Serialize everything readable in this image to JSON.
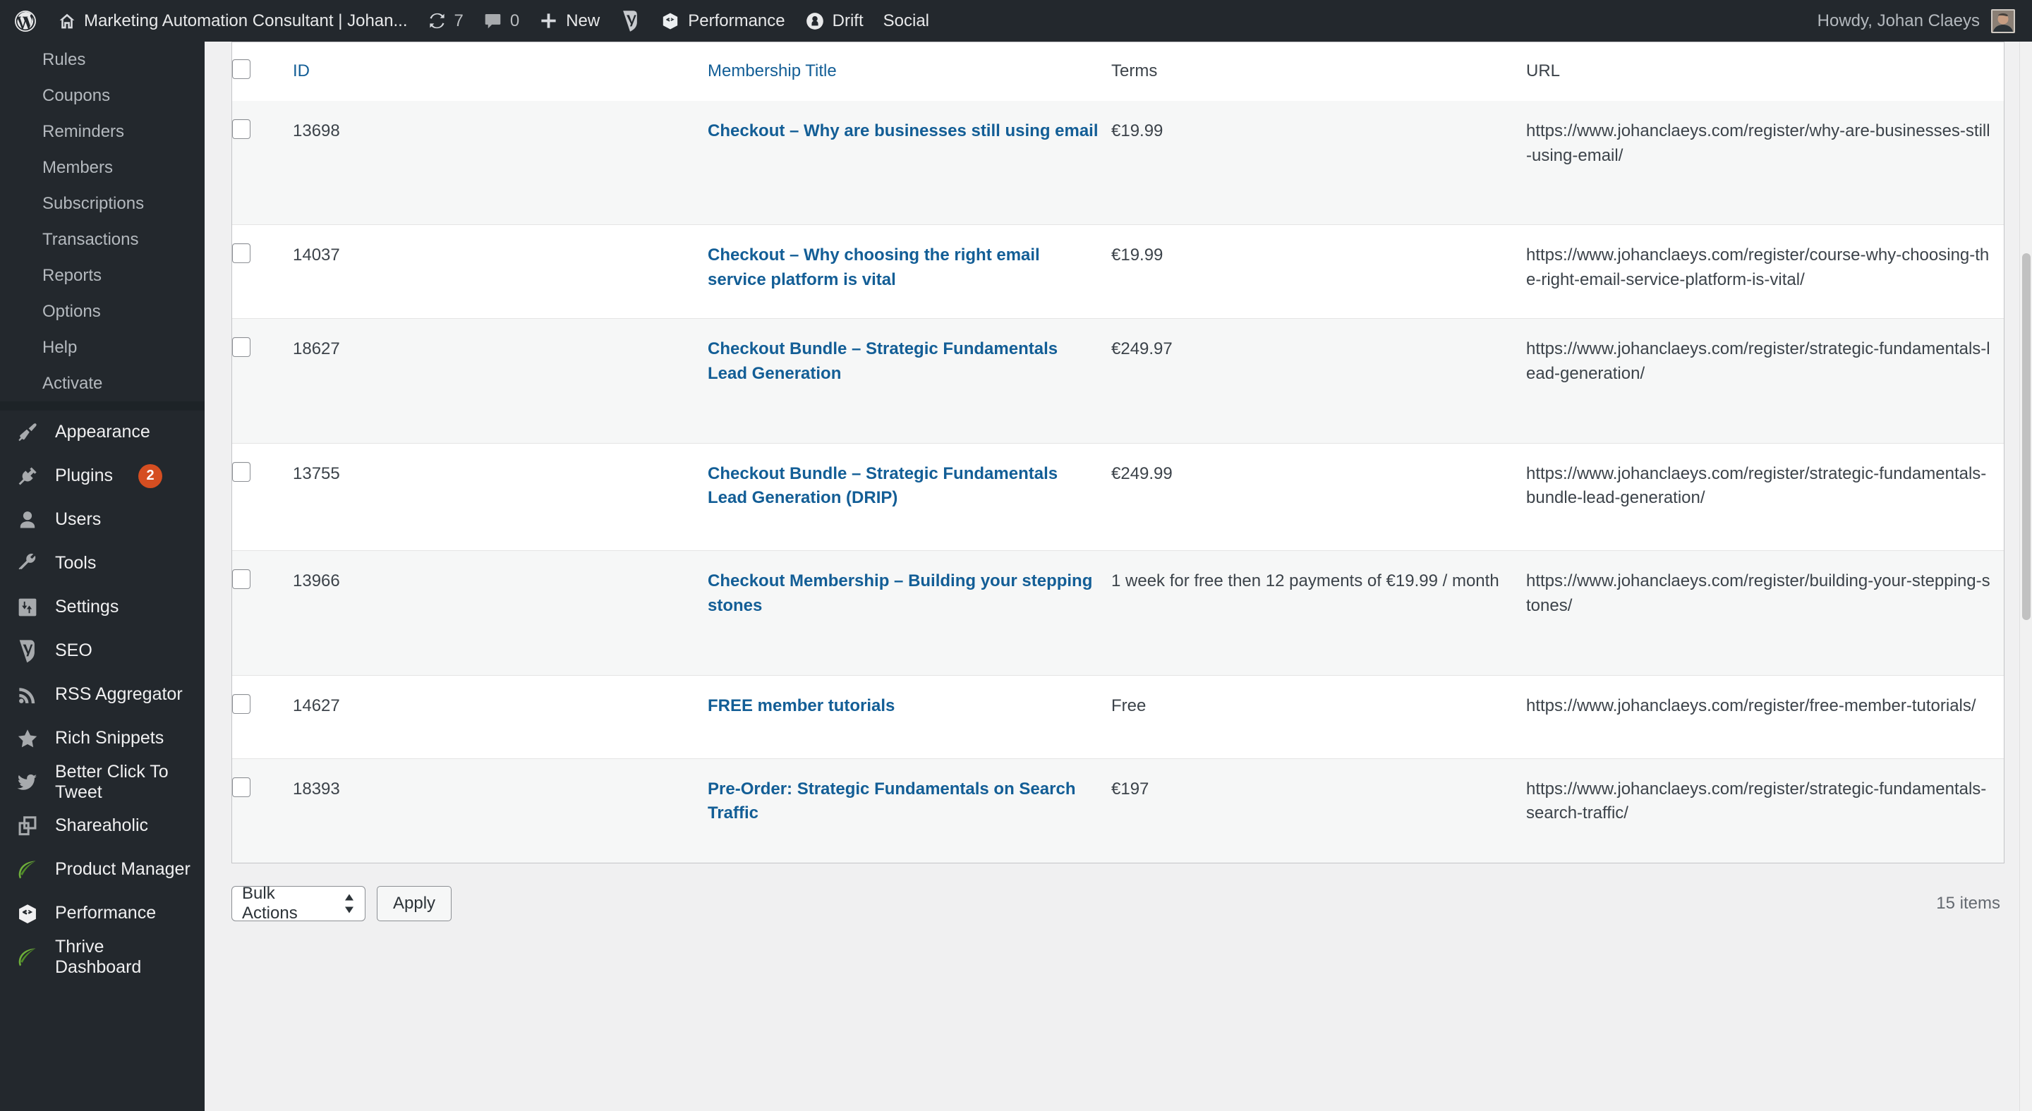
{
  "adminbar": {
    "site_title": "Marketing Automation Consultant | Johan...",
    "updates_count": "7",
    "comments_count": "0",
    "new_label": "New",
    "performance_label": "Performance",
    "drift_label": "Drift",
    "social_label": "Social",
    "howdy": "Howdy, Johan Claeys"
  },
  "sidebar": {
    "submenu": [
      {
        "label": "Rules"
      },
      {
        "label": "Coupons"
      },
      {
        "label": "Reminders"
      },
      {
        "label": "Members"
      },
      {
        "label": "Subscriptions"
      },
      {
        "label": "Transactions"
      },
      {
        "label": "Reports"
      },
      {
        "label": "Options"
      },
      {
        "label": "Help"
      },
      {
        "label": "Activate"
      }
    ],
    "topmenu": [
      {
        "label": "Appearance",
        "icon": "paintbrush-icon",
        "badge": ""
      },
      {
        "label": "Plugins",
        "icon": "plug-icon",
        "badge": "2"
      },
      {
        "label": "Users",
        "icon": "user-icon",
        "badge": ""
      },
      {
        "label": "Tools",
        "icon": "wrench-icon",
        "badge": ""
      },
      {
        "label": "Settings",
        "icon": "sliders-icon",
        "badge": ""
      },
      {
        "label": "SEO",
        "icon": "yoast-icon",
        "badge": ""
      },
      {
        "label": "RSS Aggregator",
        "icon": "rss-icon",
        "badge": ""
      },
      {
        "label": "Rich Snippets",
        "icon": "star-icon",
        "badge": ""
      },
      {
        "label": "Better Click To Tweet",
        "icon": "twitter-bird-icon",
        "badge": ""
      },
      {
        "label": "Shareaholic",
        "icon": "squares-icon",
        "badge": ""
      },
      {
        "label": "Product Manager",
        "icon": "leaf-icon",
        "badge": ""
      },
      {
        "label": "Performance",
        "icon": "cube-icon",
        "badge": ""
      },
      {
        "label": "Thrive Dashboard",
        "icon": "leaf-icon",
        "badge": ""
      }
    ]
  },
  "table": {
    "columns": [
      {
        "label": "ID",
        "link": true
      },
      {
        "label": "Membership Title",
        "link": true
      },
      {
        "label": "Terms",
        "link": false
      },
      {
        "label": "URL",
        "link": false
      }
    ],
    "rows": [
      {
        "id": "13698",
        "title": "Checkout – Why are businesses still using email",
        "terms": "€19.99",
        "url": "https://www.johanclaeys.com/register/why-are-businesses-still-using-email/"
      },
      {
        "id": "14037",
        "title": "Checkout – Why choosing the right email service platform is vital",
        "terms": "€19.99",
        "url": "https://www.johanclaeys.com/register/course-why-choosing-the-right-email-service-platform-is-vital/"
      },
      {
        "id": "18627",
        "title": "Checkout Bundle – Strategic Fundamentals Lead Generation",
        "terms": "€249.97",
        "url": "https://www.johanclaeys.com/register/strategic-fundamentals-lead-generation/"
      },
      {
        "id": "13755",
        "title": "Checkout Bundle – Strategic Fundamentals Lead Generation (DRIP)",
        "terms": "€249.99",
        "url": "https://www.johanclaeys.com/register/strategic-fundamentals-bundle-lead-generation/"
      },
      {
        "id": "13966",
        "title": "Checkout Membership – Building your stepping stones",
        "terms": "1 week for free then 12 payments of €19.99 / month",
        "url": "https://www.johanclaeys.com/register/building-your-stepping-stones/"
      },
      {
        "id": "14627",
        "title": "FREE member tutorials",
        "terms": "Free",
        "url": "https://www.johanclaeys.com/register/free-member-tutorials/"
      },
      {
        "id": "18393",
        "title": "Pre-Order: Strategic Fundamentals on Search Traffic",
        "terms": "€197",
        "url": "https://www.johanclaeys.com/register/strategic-fundamentals-search-traffic/"
      }
    ]
  },
  "tablenav": {
    "bulk_actions_label": "Bulk Actions",
    "apply_label": "Apply",
    "items_count": "15 items"
  },
  "colors": {
    "admin_bg": "#23282d",
    "link_blue": "#135e96",
    "badge_orange": "#d54e21",
    "page_bg": "#f0f0f1"
  }
}
